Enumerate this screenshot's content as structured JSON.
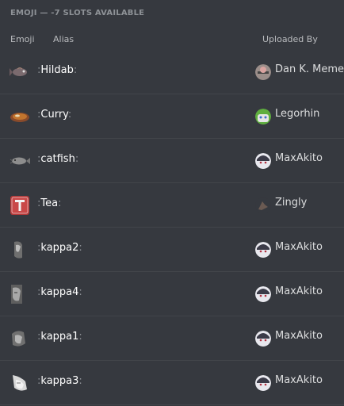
{
  "section": {
    "title": "EMOJI — -7 SLOTS AVAILABLE"
  },
  "columns": {
    "emoji": "Emoji",
    "alias": "Alias",
    "uploaded_by": "Uploaded By"
  },
  "rows": [
    {
      "alias": "Hildab",
      "uploader": "Dan K. Meme",
      "emoji_icon": "fish-icon",
      "avatar_icon": "avatar-icon"
    },
    {
      "alias": "Curry",
      "uploader": "Legorhin",
      "emoji_icon": "curry-bowl-icon",
      "avatar_icon": "avatar-icon"
    },
    {
      "alias": "catfish",
      "uploader": "MaxAkito",
      "emoji_icon": "catfish-icon",
      "avatar_icon": "avatar-icon"
    },
    {
      "alias": "Tea",
      "uploader": "Zingly",
      "emoji_icon": "t-letter-icon",
      "avatar_icon": "avatar-icon"
    },
    {
      "alias": "kappa2",
      "uploader": "MaxAkito",
      "emoji_icon": "kappa-face-icon",
      "avatar_icon": "avatar-icon"
    },
    {
      "alias": "kappa4",
      "uploader": "MaxAkito",
      "emoji_icon": "kappa-face-icon",
      "avatar_icon": "avatar-icon"
    },
    {
      "alias": "kappa1",
      "uploader": "MaxAkito",
      "emoji_icon": "kappa-face-icon",
      "avatar_icon": "avatar-icon"
    },
    {
      "alias": "kappa3",
      "uploader": "MaxAkito",
      "emoji_icon": "kappa-face-icon",
      "avatar_icon": "avatar-icon"
    }
  ],
  "colors": {
    "background": "#36393f",
    "divider": "#42454a",
    "header_text": "#8e9297",
    "text": "#dcddde"
  }
}
